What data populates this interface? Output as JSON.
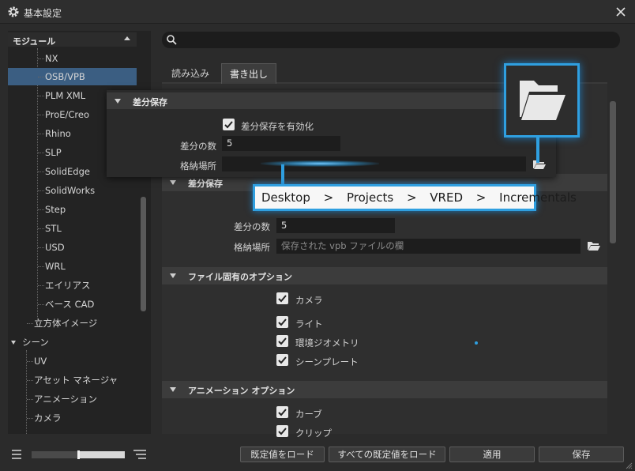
{
  "window": {
    "title": "基本設定"
  },
  "sidebar": {
    "module_header": "モジュール",
    "items": [
      {
        "label": "NX"
      },
      {
        "label": "OSB/VPB",
        "selected": true
      },
      {
        "label": "PLM XML"
      },
      {
        "label": "ProE/Creo"
      },
      {
        "label": "Rhino"
      },
      {
        "label": "SLP"
      },
      {
        "label": "SolidEdge"
      },
      {
        "label": "SolidWorks"
      },
      {
        "label": "Step"
      },
      {
        "label": "STL"
      },
      {
        "label": "USD"
      },
      {
        "label": "WRL"
      },
      {
        "label": "エイリアス"
      },
      {
        "label": "ベース CAD"
      }
    ],
    "cube_image": "立方体イメージ",
    "scene_group": "シーン",
    "scene_items": [
      {
        "label": "UV"
      },
      {
        "label": "アセット マネージャ"
      },
      {
        "label": "アニメーション"
      },
      {
        "label": "カメラ"
      }
    ]
  },
  "search": {
    "placeholder": ""
  },
  "tabs": [
    {
      "label": "読み込み"
    },
    {
      "label": "書き出し",
      "active": true
    }
  ],
  "overlay": {
    "section": "差分保存",
    "enable_label": "差分保存を有効化",
    "count_label": "差分の数",
    "count_value": "5",
    "location_label": "格納場所",
    "path": [
      "Desktop",
      ">",
      "Projects",
      ">",
      "VRED",
      ">",
      "Incrementals"
    ]
  },
  "incremental": {
    "section": "差分保存",
    "count_label": "差分の数",
    "count_value": "5",
    "location_label": "格納場所",
    "location_placeholder": "保存された vpb ファイルの欄"
  },
  "file_options": {
    "section": "ファイル固有のオプション",
    "items": [
      {
        "label": "カメラ",
        "checked": true
      },
      {
        "label": "ライト",
        "checked": true
      },
      {
        "label": "環境ジオメトリ",
        "checked": true
      },
      {
        "label": "シーンプレート",
        "checked": true
      }
    ]
  },
  "animation_options": {
    "section": "アニメーション オプション",
    "items": [
      {
        "label": "カーブ",
        "checked": true
      },
      {
        "label": "クリップ",
        "checked": true
      }
    ]
  },
  "footer": {
    "load_default": "既定値をロード",
    "load_all_defaults": "すべての既定値をロード",
    "apply": "適用",
    "save": "保存",
    "zoom_slider": 0.5
  },
  "colors": {
    "accent": "#2f9fe0",
    "selection": "#3b5e82"
  }
}
